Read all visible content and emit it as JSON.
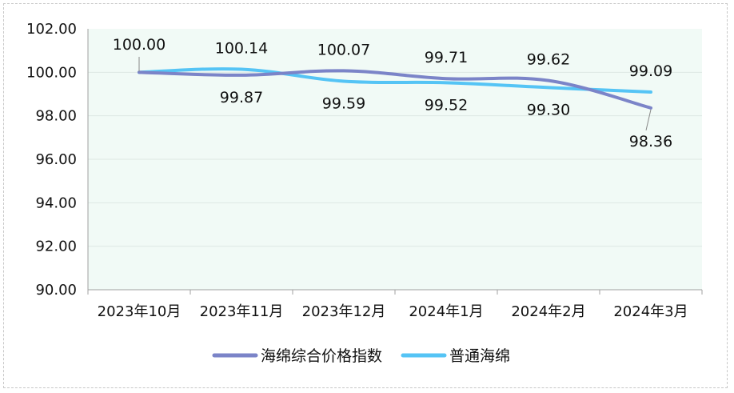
{
  "chart_data": {
    "type": "line",
    "categories": [
      "2023年10月",
      "2023年11月",
      "2023年12月",
      "2024年1月",
      "2024年2月",
      "2024年3月"
    ],
    "series": [
      {
        "name": "海绵综合价格指数",
        "values": [
          100.0,
          99.87,
          100.07,
          99.71,
          99.62,
          98.36
        ],
        "color": "#7b84c8"
      },
      {
        "name": "普通海绵",
        "values": [
          100.0,
          100.14,
          99.59,
          99.52,
          99.3,
          99.09
        ],
        "color": "#55c4f5"
      }
    ],
    "y_ticks": [
      "90.00",
      "92.00",
      "94.00",
      "96.00",
      "98.00",
      "100.00",
      "102.00"
    ],
    "ylim": [
      90,
      102
    ],
    "plot_background": "#f1faf6",
    "grid": true,
    "legend_position": "bottom",
    "data_labels": true
  }
}
